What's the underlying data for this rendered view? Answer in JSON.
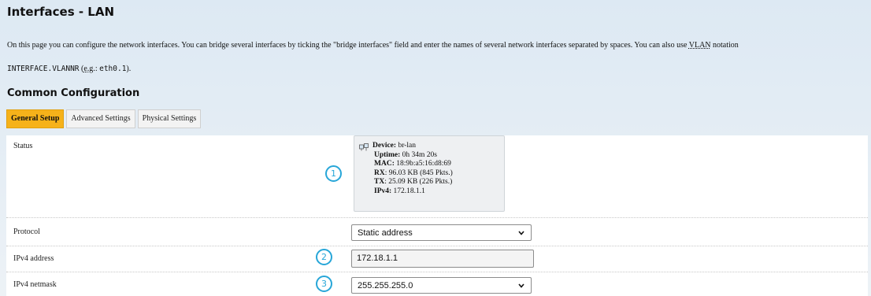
{
  "page": {
    "title": "Interfaces - LAN",
    "description_main": "On this page you can configure the network interfaces. You can bridge several interfaces by ticking the \"bridge interfaces\" field and enter the names of several network interfaces separated by spaces. You can also use ",
    "description_vlan": "VLAN",
    "description_notation": " notation",
    "notation_code": "INTERFACE.VLANNR",
    "notation_eg": "e.g.",
    "notation_example": "eth0.1",
    "section_title": "Common Configuration"
  },
  "tabs": [
    {
      "label": "General Setup",
      "active": true
    },
    {
      "label": "Advanced Settings",
      "active": false
    },
    {
      "label": "Physical Settings",
      "active": false
    }
  ],
  "status": {
    "label": "Status",
    "device_label": "Device:",
    "device_value": "br-lan",
    "uptime_label": "Uptime:",
    "uptime_value": "0h 34m 20s",
    "mac_label": "MAC:",
    "mac_value": "18:9b:a5:16:d8:69",
    "rx_label": "RX",
    "rx_value": ": 96.03 KB (845 Pkts.)",
    "tx_label": "TX",
    "tx_value": ": 25.09 KB (226 Pkts.)",
    "ipv4_label": "IPv4:",
    "ipv4_value": "172.18.1.1"
  },
  "protocol": {
    "label": "Protocol",
    "value": "Static address"
  },
  "ipv4_address": {
    "label": "IPv4 address",
    "value": "172.18.1.1"
  },
  "ipv4_netmask": {
    "label": "IPv4 netmask",
    "value": "255.255.255.0"
  },
  "callouts": [
    "1",
    "2",
    "3"
  ],
  "colors": {
    "accent": "#f6b21a",
    "callout": "#27a6d8"
  }
}
